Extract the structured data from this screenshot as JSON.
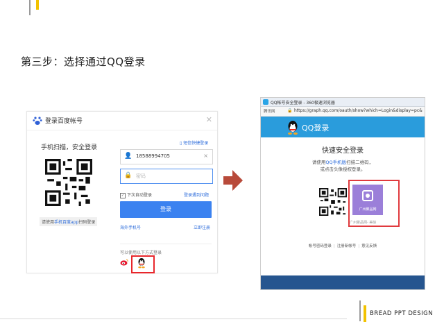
{
  "slide": {
    "step_title": "第三步：选择通过QQ登录",
    "brand": "BREAD PPT DESIGN"
  },
  "baidu_login": {
    "title": "登录百度帐号",
    "close_icon": "close-icon",
    "scan_heading": "手机扫描，安全登录",
    "scan_tip_prefix": "请使用",
    "scan_tip_link": "手机百度app",
    "scan_tip_suffix": "扫码登录",
    "sms_login_link": "短信快捷登录",
    "username_value": "18588994705",
    "password_placeholder": "密码",
    "auto_login_label": "下次自动登录",
    "login_problem_link": "登录遇到问题",
    "login_button": "登录",
    "overseas_phone_link": "海外手机号",
    "register_link": "立即注册",
    "other_login_label": "可以使用以下方式登录",
    "icons": [
      "baidu-paw-icon",
      "phone-icon",
      "user-icon",
      "lock-icon",
      "weibo-icon",
      "qq-icon"
    ],
    "highlight_color": "#e8262b",
    "button_color": "#3b82f0"
  },
  "qq_browser": {
    "window_title": "QQ帐号安全登录 - 360极速浏览器",
    "toolbar_text": "腾讯网",
    "url": "https://graph.qq.com/oauth/show?which=Login&display=pc&",
    "header_title": "QQ登录",
    "fast_title": "快速安全登录",
    "desc_prefix": "请使用",
    "desc_link": "QQ手机版",
    "desc_suffix": "扫描二维码，",
    "desc_line2": "或点击头像授权登录。",
    "avatar_label": "广州聚品网",
    "avatar_name": "广州聚品网- 美徐",
    "footer": [
      "帐号密码登录",
      "注册新帐号",
      "意见反馈"
    ],
    "header_color": "#2a9cdc",
    "highlight_color": "#e03a3e"
  }
}
